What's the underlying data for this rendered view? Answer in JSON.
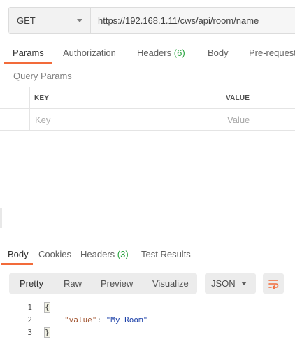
{
  "request": {
    "method": "GET",
    "url": "https://192.168.1.11/cws/api/room/name"
  },
  "request_tabs": {
    "params": "Params",
    "authorization": "Authorization",
    "headers": "Headers",
    "headers_count": "(6)",
    "body": "Body",
    "pre_request": "Pre-request"
  },
  "query_params": {
    "title": "Query Params",
    "columns": {
      "key": "KEY",
      "value": "VALUE"
    },
    "placeholders": {
      "key": "Key",
      "value": "Value"
    }
  },
  "response_tabs": {
    "body": "Body",
    "cookies": "Cookies",
    "headers": "Headers",
    "headers_count": "(3)",
    "test_results": "Test Results"
  },
  "view": {
    "pretty": "Pretty",
    "raw": "Raw",
    "preview": "Preview",
    "visualize": "Visualize",
    "format": "JSON"
  },
  "code": {
    "lines": [
      "1",
      "2",
      "3"
    ],
    "open_brace": "{",
    "key": "\"value\"",
    "colon": ": ",
    "value": "\"My Room\"",
    "close_brace": "}"
  },
  "colors": {
    "accent": "#f26b3a",
    "count": "#26a33d"
  }
}
